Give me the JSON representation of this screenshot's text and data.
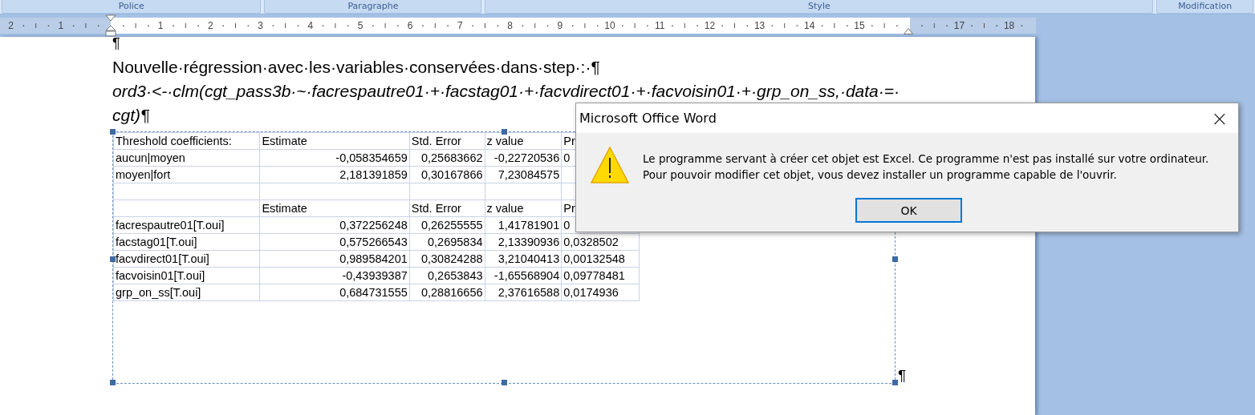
{
  "ribbon_groups": [
    "Police",
    "Paragraphe",
    "Style",
    "Modification"
  ],
  "ruler": {
    "left_numbers": [
      "2",
      "1"
    ],
    "numbers": [
      "1",
      "2",
      "3",
      "4",
      "5",
      "6",
      "7",
      "8",
      "9",
      "10",
      "11",
      "12",
      "13",
      "14",
      "15"
    ],
    "after_indent_numbers": [
      "17",
      "18"
    ]
  },
  "document": {
    "paragraph_mark": "¶",
    "heading": "Nouvelle·régression·avec·les·variables·conservées·dans·step·:·¶",
    "code_lines": [
      "ord3·<-·clm(cgt_pass3b·~·facrespautre01·+·facstag01·+·facvdirect01·+·facvoisin01·+·grp_on_ss,·data·=·",
      "cgt)¶"
    ],
    "table_rows": [
      {
        "cells": [
          "Threshold coefficients:",
          "Estimate",
          "Std. Error",
          "z value",
          "Pr"
        ]
      },
      {
        "cells": [
          "aucun|moyen",
          "-0,058354659",
          "0,25683662",
          "-0,22720536",
          "0"
        ]
      },
      {
        "cells": [
          "moyen|fort",
          "2,181391859",
          "0,30167866",
          "7,23084575"
        ]
      },
      {
        "cells": []
      },
      {
        "cells": [
          "",
          "Estimate",
          "Std. Error",
          "z value",
          "Pr"
        ]
      },
      {
        "cells": [
          "facrespautre01[T.oui]",
          "0,372256248",
          "0,26255555",
          "1,41781901",
          "0"
        ]
      },
      {
        "cells": [
          "facstag01[T.oui]",
          "0,575266543",
          "0,2695834",
          "2,13390936",
          "0,0328502"
        ]
      },
      {
        "cells": [
          "facvdirect01[T.oui]",
          "0,989584201",
          "0,30824288",
          "3,21040413",
          "0,00132548"
        ]
      },
      {
        "cells": [
          "facvoisin01[T.oui]",
          "-0,43939387",
          "0,2653843",
          "-1,65568904",
          "0,09778481"
        ]
      },
      {
        "cells": [
          "grp_on_ss[T.oui]",
          "0,684731555",
          "0,28816656",
          "2,37616588",
          "0,0174936"
        ]
      }
    ],
    "trailing_mark": "¶"
  },
  "dialog": {
    "title": "Microsoft Office Word",
    "close": "×",
    "message_lines": [
      "Le programme servant à créer cet objet est Excel. Ce programme n'est pas installé sur votre ordinateur.",
      "Pour pouvoir modifier cet objet, vous devez installer un programme capable de l'ouvrir."
    ],
    "button": "OK"
  }
}
